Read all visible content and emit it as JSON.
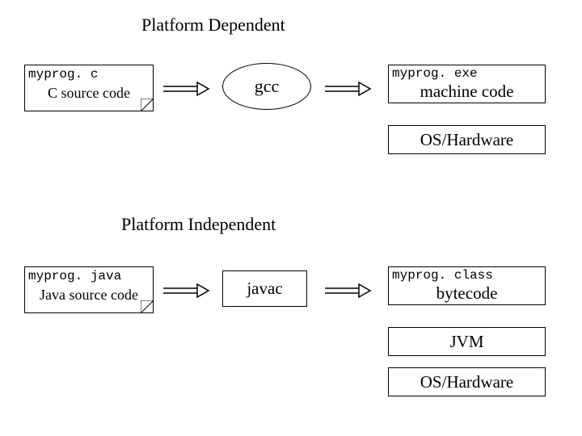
{
  "section_c": {
    "heading": "Platform Dependent",
    "source": {
      "filename": "myprog. c",
      "filetype": "C source code"
    },
    "compiler": "gcc",
    "output": {
      "filename": "myprog. exe",
      "description": "machine code"
    },
    "layers": [
      "OS/Hardware"
    ]
  },
  "section_java": {
    "heading": "Platform Independent",
    "source": {
      "filename": "myprog. java",
      "filetype": "Java source code"
    },
    "compiler": "javac",
    "output": {
      "filename": "myprog. class",
      "description": "bytecode"
    },
    "layers": [
      "JVM",
      "OS/Hardware"
    ]
  }
}
